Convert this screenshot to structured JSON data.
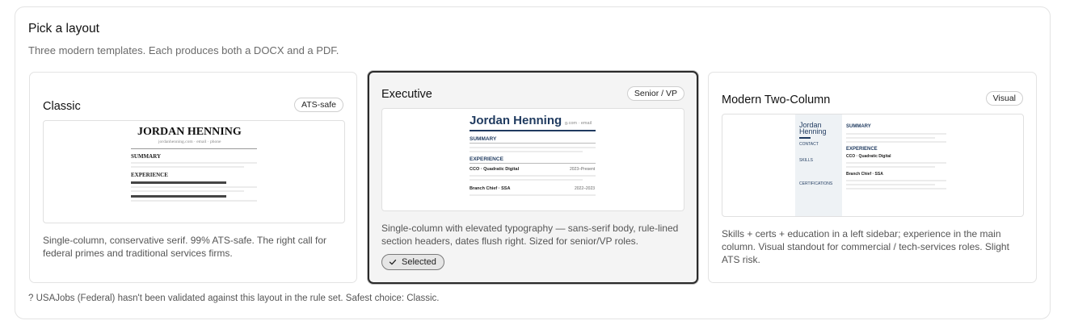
{
  "section": {
    "title": "Pick a layout",
    "subtitle": "Three modern templates. Each produces both a DOCX and a PDF."
  },
  "cards": [
    {
      "id": "classic",
      "title": "Classic",
      "badge": "ATS-safe",
      "selected": false,
      "description": "Single-column, conservative serif. 99% ATS-safe. The right call for federal primes and traditional services firms.",
      "preview": {
        "name": "JORDAN HENNING",
        "contact": "jordanhenning.com · email · phone",
        "section1": "SUMMARY",
        "section2": "EXPERIENCE"
      }
    },
    {
      "id": "executive",
      "title": "Executive",
      "badge": "Senior / VP",
      "selected": true,
      "selected_label": "Selected",
      "description": "Single-column with elevated typography — sans-serif body, rule-lined section headers, dates flush right. Sized for senior/VP roles.",
      "preview": {
        "name": "Jordan Henning",
        "contact": "g.com · email",
        "section1": "SUMMARY",
        "section2": "EXPERIENCE",
        "job1": "CCO · Quadratic Digital",
        "job1_dates": "2023–Present",
        "job2": "Branch Chief · SSA",
        "job2_dates": "2022–2023"
      }
    },
    {
      "id": "modern-two-column",
      "title": "Modern Two-Column",
      "badge": "Visual",
      "selected": false,
      "description": "Skills + certs + education in a left sidebar; experience in the main column. Visual standout for commercial / tech-services roles. Slight ATS risk.",
      "preview": {
        "name_line1": "Jordan",
        "name_line2": "Henning",
        "side1": "CONTACT",
        "side2": "SKILLS",
        "side3": "CERTIFICATIONS",
        "main1": "SUMMARY",
        "main2": "EXPERIENCE",
        "job1": "CCO · Quadratic Digital",
        "job2": "Branch Chief · SSA"
      }
    }
  ],
  "footnote": "? USAJobs (Federal) hasn't been validated against this layout in the rule set. Safest choice: Classic.",
  "colors": {
    "accent_navy": "#1f3a5f",
    "selected_border": "#2a2a2a",
    "sidebar_bg": "#eef2f5"
  }
}
